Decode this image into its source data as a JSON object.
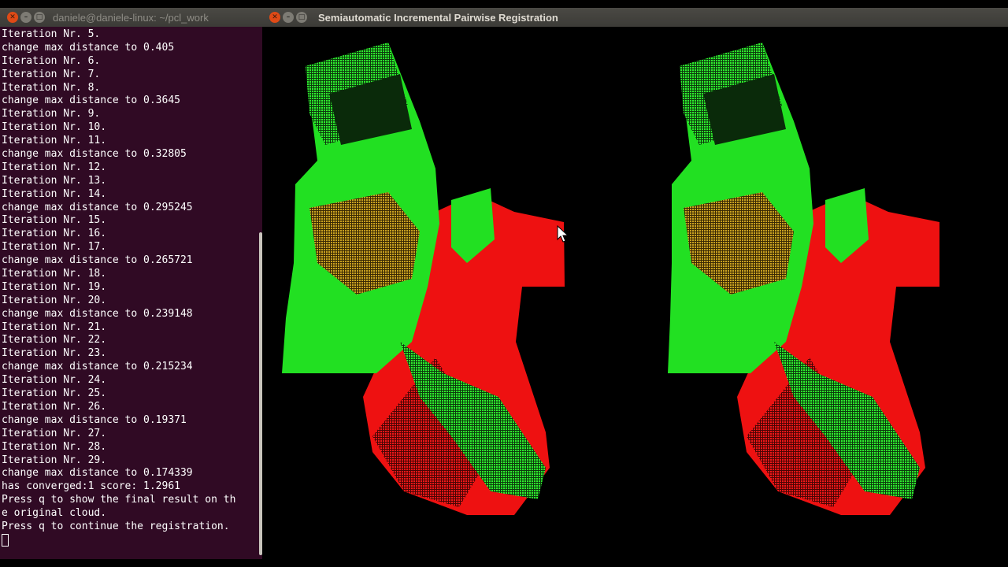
{
  "terminal": {
    "title": "daniele@daniele-linux: ~/pcl_work",
    "lines": [
      "Iteration Nr. 5.",
      "change max distance to 0.405",
      "Iteration Nr. 6.",
      "Iteration Nr. 7.",
      "Iteration Nr. 8.",
      "change max distance to 0.3645",
      "Iteration Nr. 9.",
      "Iteration Nr. 10.",
      "Iteration Nr. 11.",
      "change max distance to 0.32805",
      "Iteration Nr. 12.",
      "Iteration Nr. 13.",
      "Iteration Nr. 14.",
      "change max distance to 0.295245",
      "Iteration Nr. 15.",
      "Iteration Nr. 16.",
      "Iteration Nr. 17.",
      "change max distance to 0.265721",
      "Iteration Nr. 18.",
      "Iteration Nr. 19.",
      "Iteration Nr. 20.",
      "change max distance to 0.239148",
      "Iteration Nr. 21.",
      "Iteration Nr. 22.",
      "Iteration Nr. 23.",
      "change max distance to 0.215234",
      "Iteration Nr. 24.",
      "Iteration Nr. 25.",
      "Iteration Nr. 26.",
      "change max distance to 0.19371",
      "Iteration Nr. 27.",
      "Iteration Nr. 28.",
      "Iteration Nr. 29.",
      "change max distance to 0.174339",
      "has converged:1 score: 1.2961",
      "Press q to show the final result on th",
      "e original cloud.",
      "Press q to continue the registration."
    ]
  },
  "viewer": {
    "title": "Semiautomatic Incremental Pairwise Registration"
  },
  "colors": {
    "terminal_bg": "#300a24",
    "source_cloud": "#22e022",
    "target_cloud": "#ee1111",
    "close_button": "#df4a16"
  },
  "icons": [
    "close-icon",
    "minimize-icon",
    "maximize-icon",
    "mouse-cursor-icon"
  ]
}
